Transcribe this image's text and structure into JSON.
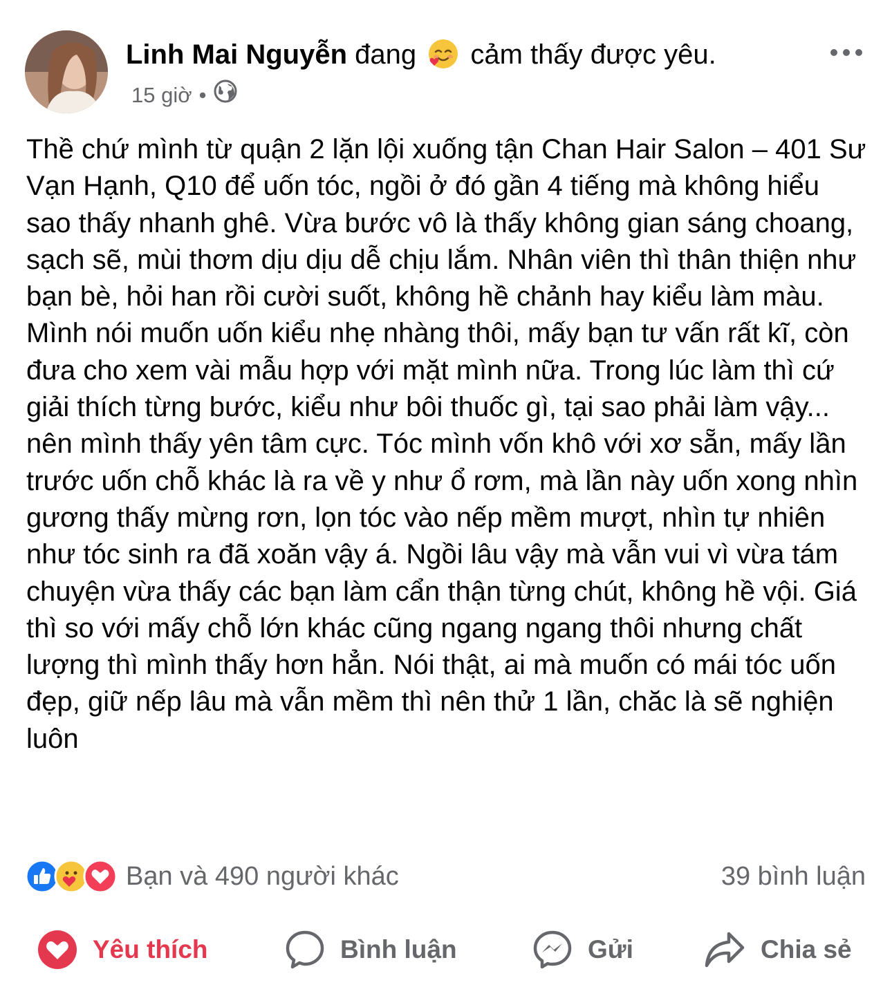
{
  "post": {
    "author": "Linh Mai Nguyễn",
    "status_prefix": "đang",
    "feeling": "cảm thấy được yêu.",
    "feeling_icon": "smiling-heart-face-icon",
    "time": "15 giờ",
    "separator": "•",
    "privacy_icon": "globe-icon",
    "text": "Thề chứ mình từ quận 2 lặn lội xuống tận Chan Hair Salon – 401 Sư Vạn Hạnh, Q10 để uốn tóc, ngồi ở đó gần 4 tiếng mà không hiểu sao thấy nhanh ghê. Vừa bước vô là thấy không gian sáng choang, sạch sẽ, mùi thơm dịu dịu dễ chịu lắm. Nhân viên thì thân thiện như bạn bè, hỏi han rồi cười suốt, không hề chảnh hay kiểu làm màu. Mình nói muốn uốn kiểu nhẹ nhàng thôi, mấy bạn tư vấn rất kĩ, còn đưa cho xem vài mẫu hợp với mặt mình nữa. Trong lúc làm thì cứ giải thích từng bước, kiểu như bôi thuốc gì, tại sao phải làm vậy... nên mình thấy yên tâm cực. Tóc mình vốn khô với xơ sẵn, mấy lần trước uốn chỗ khác là ra về y như ổ rơm, mà lần này uốn xong nhìn gương thấy mừng rơn, lọn tóc vào nếp mềm mượt, nhìn tự nhiên như tóc sinh ra đã xoăn vậy á. Ngồi lâu vậy mà vẫn vui vì vừa tám chuyện vừa thấy các bạn làm cẩn thận từng chút, không hề vội. Giá thì so với mấy chỗ lớn khác cũng ngang ngang thôi nhưng chất lượng thì mình thấy hơn hẳn. Nói thật, ai mà muốn có mái tóc uốn đẹp, giữ nếp lâu mà vẫn mềm thì nên thử 1 lần, chăc là sẽ nghiện luôn"
  },
  "stats": {
    "reaction_icons": [
      "like-icon",
      "care-icon",
      "love-icon"
    ],
    "reactions_text": "Bạn và 490 người khác",
    "comments_text": "39 bình luận"
  },
  "actions": {
    "like": "Yêu thích",
    "comment": "Bình luận",
    "send": "Gửi",
    "share": "Chia sẻ"
  },
  "colors": {
    "like_active": "#e4384f",
    "secondary_text": "#65676b",
    "like_blue": "#1877f2"
  }
}
